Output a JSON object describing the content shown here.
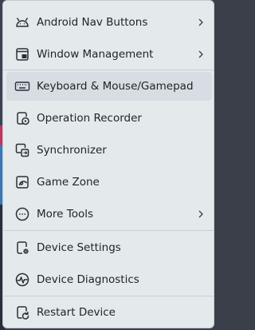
{
  "menu": {
    "items": [
      {
        "label": "Android Nav Buttons",
        "icon": "android-icon",
        "submenu": true
      },
      {
        "label": "Window Management",
        "icon": "window-icon",
        "submenu": true
      },
      {
        "label": "Keyboard & Mouse/Gamepad",
        "icon": "keyboard-icon",
        "submenu": false
      },
      {
        "label": "Operation Recorder",
        "icon": "recorder-icon",
        "submenu": false
      },
      {
        "label": "Synchronizer",
        "icon": "synchronizer-icon",
        "submenu": false
      },
      {
        "label": "Game Zone",
        "icon": "game-zone-icon",
        "submenu": false
      },
      {
        "label": "More Tools",
        "icon": "more-tools-icon",
        "submenu": true
      },
      {
        "label": "Device Settings",
        "icon": "device-settings-icon",
        "submenu": false
      },
      {
        "label": "Device Diagnostics",
        "icon": "diagnostics-icon",
        "submenu": false
      },
      {
        "label": "Restart Device",
        "icon": "restart-icon",
        "submenu": false
      }
    ]
  },
  "colors": {
    "menu_bg": "#e4e9ec",
    "highlight_bg": "#d7dde2",
    "text": "#1f2328",
    "icon": "#2b3036"
  }
}
